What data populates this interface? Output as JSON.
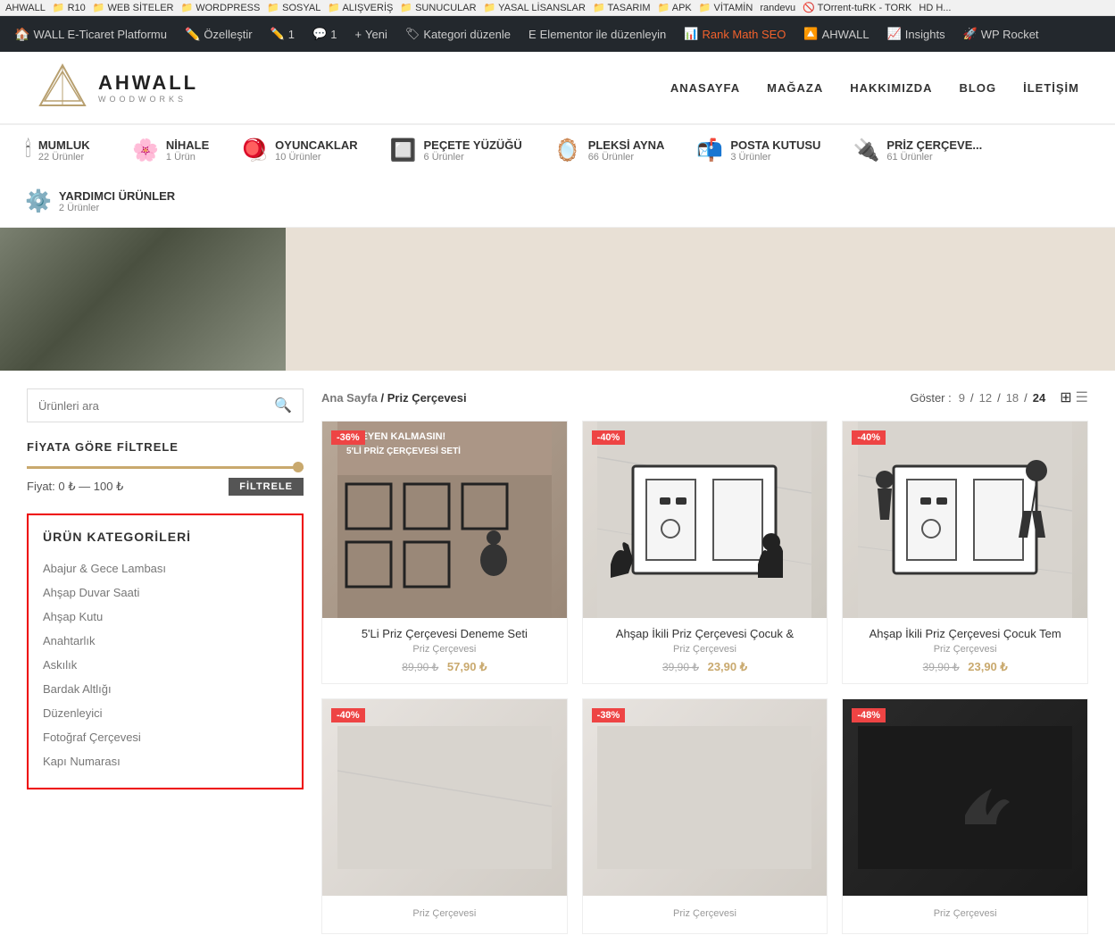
{
  "bookmarks": {
    "items": [
      "AHWALL",
      "R10",
      "WEB SİTELER",
      "WORDPRESS",
      "SOSYAL",
      "ALIŞVERİŞ",
      "SUNUCULAR",
      "YASAL LİSANSLAR",
      "TASARIM",
      "APK",
      "VİTAMİN",
      "randevu",
      "TOrrent-tuRK - TORK",
      "HD H..."
    ]
  },
  "admin_bar": {
    "site_name": "WALL E-Ticaret Platformu",
    "customize": "Özelleştir",
    "comments_count": "1",
    "edits_count": "1",
    "new_label": "Yeni",
    "category_edit": "Kategori düzenle",
    "elementor": "Elementor ile düzenleyin",
    "rank_math": "Rank Math SEO",
    "ahwall": "AHWALL",
    "insights": "Insights",
    "wp_rocket": "WP Rocket"
  },
  "site": {
    "logo_text": "AHWALL",
    "logo_sub": "WOODWORKS",
    "nav": [
      {
        "label": "ANASAYFA"
      },
      {
        "label": "MAĞAZA"
      },
      {
        "label": "HAKKIMIZDA"
      },
      {
        "label": "BLOG"
      },
      {
        "label": "İLETİŞİM"
      }
    ]
  },
  "categories": [
    {
      "icon": "🕯",
      "name": "MUMLUK",
      "count": "22 Ürünler"
    },
    {
      "icon": "🌸",
      "name": "NİHALE",
      "count": "1 Ürün"
    },
    {
      "icon": "🪀",
      "name": "OYUNCAKLAR",
      "count": "10 Ürünler"
    },
    {
      "icon": "🔲",
      "name": "PEÇETE YÜZÜĞÜ",
      "count": "6 Ürünler"
    },
    {
      "icon": "🪞",
      "name": "PLEKSİ AYNA",
      "count": "66 Ürünler"
    },
    {
      "icon": "📦",
      "name": "POSTA KUTUSU",
      "count": "3 Ürünler"
    },
    {
      "icon": "🔌",
      "name": "PRİZ ÇERÇEVE...",
      "count": "61 Ürünler"
    },
    {
      "icon": "⚙️",
      "name": "YARDIMCI ÜRÜNLER",
      "count": "2 Ürünler"
    }
  ],
  "sidebar": {
    "search_placeholder": "Ürünleri ara",
    "filter_title": "FİYATA GÖRE FİLTRELE",
    "price_label": "Fiyat: 0 ₺ — 100 ₺",
    "filter_btn": "FİLTRELE",
    "categories_title": "ÜRÜN KATEGORİLERİ",
    "category_items": [
      "Abajur & Gece Lambası",
      "Ahşap Duvar Saati",
      "Ahşap Kutu",
      "Anahtarlık",
      "Askılık",
      "Bardak Altlığı",
      "Düzenleyici",
      "Fotoğraf Çerçevesi",
      "Kapı Numarası"
    ]
  },
  "breadcrumb": {
    "home": "Ana Sayfa",
    "separator": "/",
    "current": "Priz Çerçevesi"
  },
  "view": {
    "show_label": "Göster :",
    "options": [
      "9",
      "12",
      "18",
      "24"
    ],
    "active": "24"
  },
  "products": [
    {
      "badge": "-36%",
      "badge_color": "red",
      "name": "5'Li Priz Çerçevesi Deneme Seti",
      "category": "Priz Çerçevesi",
      "old_price": "89,90 ₺",
      "new_price": "57,90 ₺",
      "img_type": "socket-set"
    },
    {
      "badge": "-40%",
      "badge_color": "red",
      "name": "Ahşap İkili Priz Çerçevesi Çocuk &",
      "category": "Priz Çerçevesi",
      "old_price": "39,90 ₺",
      "new_price": "23,90 ₺",
      "img_type": "marble"
    },
    {
      "badge": "-40%",
      "badge_color": "red",
      "name": "Ahşap İkili Priz Çerçevesi Çocuk Tem",
      "category": "Priz Çerçevesi",
      "old_price": "39,90 ₺",
      "new_price": "23,90 ₺",
      "img_type": "marble2"
    },
    {
      "badge": "-40%",
      "badge_color": "red",
      "name": "",
      "category": "Priz Çerçevesi",
      "old_price": "",
      "new_price": "",
      "img_type": "bottom1"
    },
    {
      "badge": "-38%",
      "badge_color": "red",
      "name": "",
      "category": "Priz Çerçevesi",
      "old_price": "",
      "new_price": "",
      "img_type": "bottom2"
    },
    {
      "badge": "-48%",
      "badge_color": "red",
      "name": "",
      "category": "Priz Çerçevesi",
      "old_price": "",
      "new_price": "",
      "img_type": "bottom3"
    }
  ]
}
